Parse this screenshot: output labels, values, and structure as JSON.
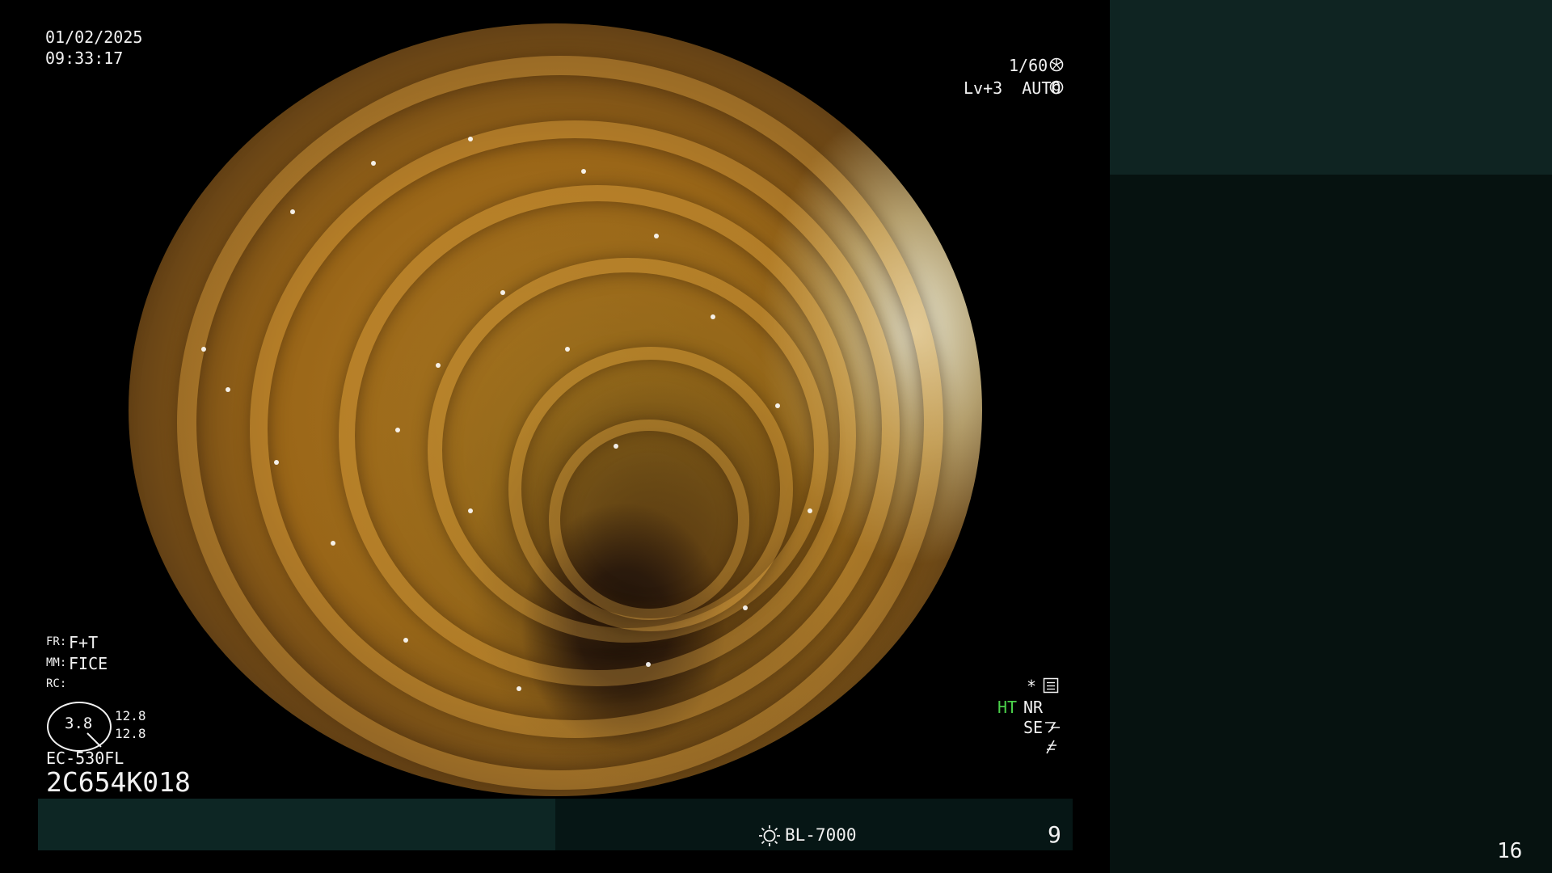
{
  "overlay": {
    "date": "01/02/2025",
    "time": "09:33:17",
    "shutter": "1/60",
    "iris": "Lv+3  AUTO",
    "fr_label": "FR:",
    "fr_value": "F+T",
    "mm_label": "MM:",
    "mm_value": "FICE",
    "rc_label": "RC:",
    "rc_dial_value": "3.8",
    "rc_value_1": "12.8",
    "rc_value_2": "12.8",
    "scope_model": "EC-530FL",
    "serial": "2C654K018",
    "ht_label": "HT",
    "nr_label": "NR",
    "se_label": "SE",
    "asterisk": "*"
  },
  "bottom_bar": {
    "light_source": "BL-7000",
    "number": "9"
  },
  "right_panel": {
    "page_number": "16"
  },
  "colors": {
    "ht_green": "#4ad04a",
    "panel_teal": "#0d2624"
  },
  "icons": [
    "shutter-icon",
    "iris-icon",
    "menu-icon",
    "enhancement-icon",
    "sharpness-icon",
    "sun-icon"
  ]
}
